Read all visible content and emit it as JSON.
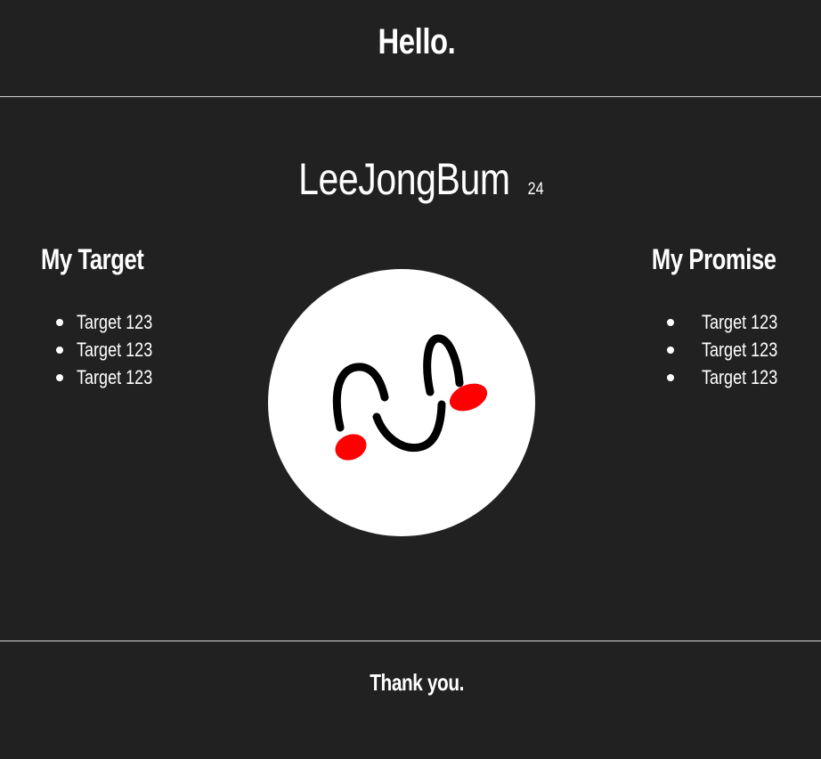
{
  "header": {
    "title": "Hello."
  },
  "profile": {
    "name": "LeeJongBum",
    "age": "24",
    "avatar_icon": "smiley-face-icon",
    "avatar_bg": "#ffffff",
    "cheek_color": "#ff0000"
  },
  "left_column": {
    "title": "My Target",
    "items": [
      "Target 123",
      "Target 123",
      "Target 123"
    ]
  },
  "right_column": {
    "title": "My Promise",
    "items": [
      "Target 123",
      "Target 123",
      "Target 123"
    ]
  },
  "footer": {
    "text": "Thank you."
  },
  "colors": {
    "background": "#212121",
    "text": "#ffffff",
    "divider": "#d8d8d8"
  }
}
